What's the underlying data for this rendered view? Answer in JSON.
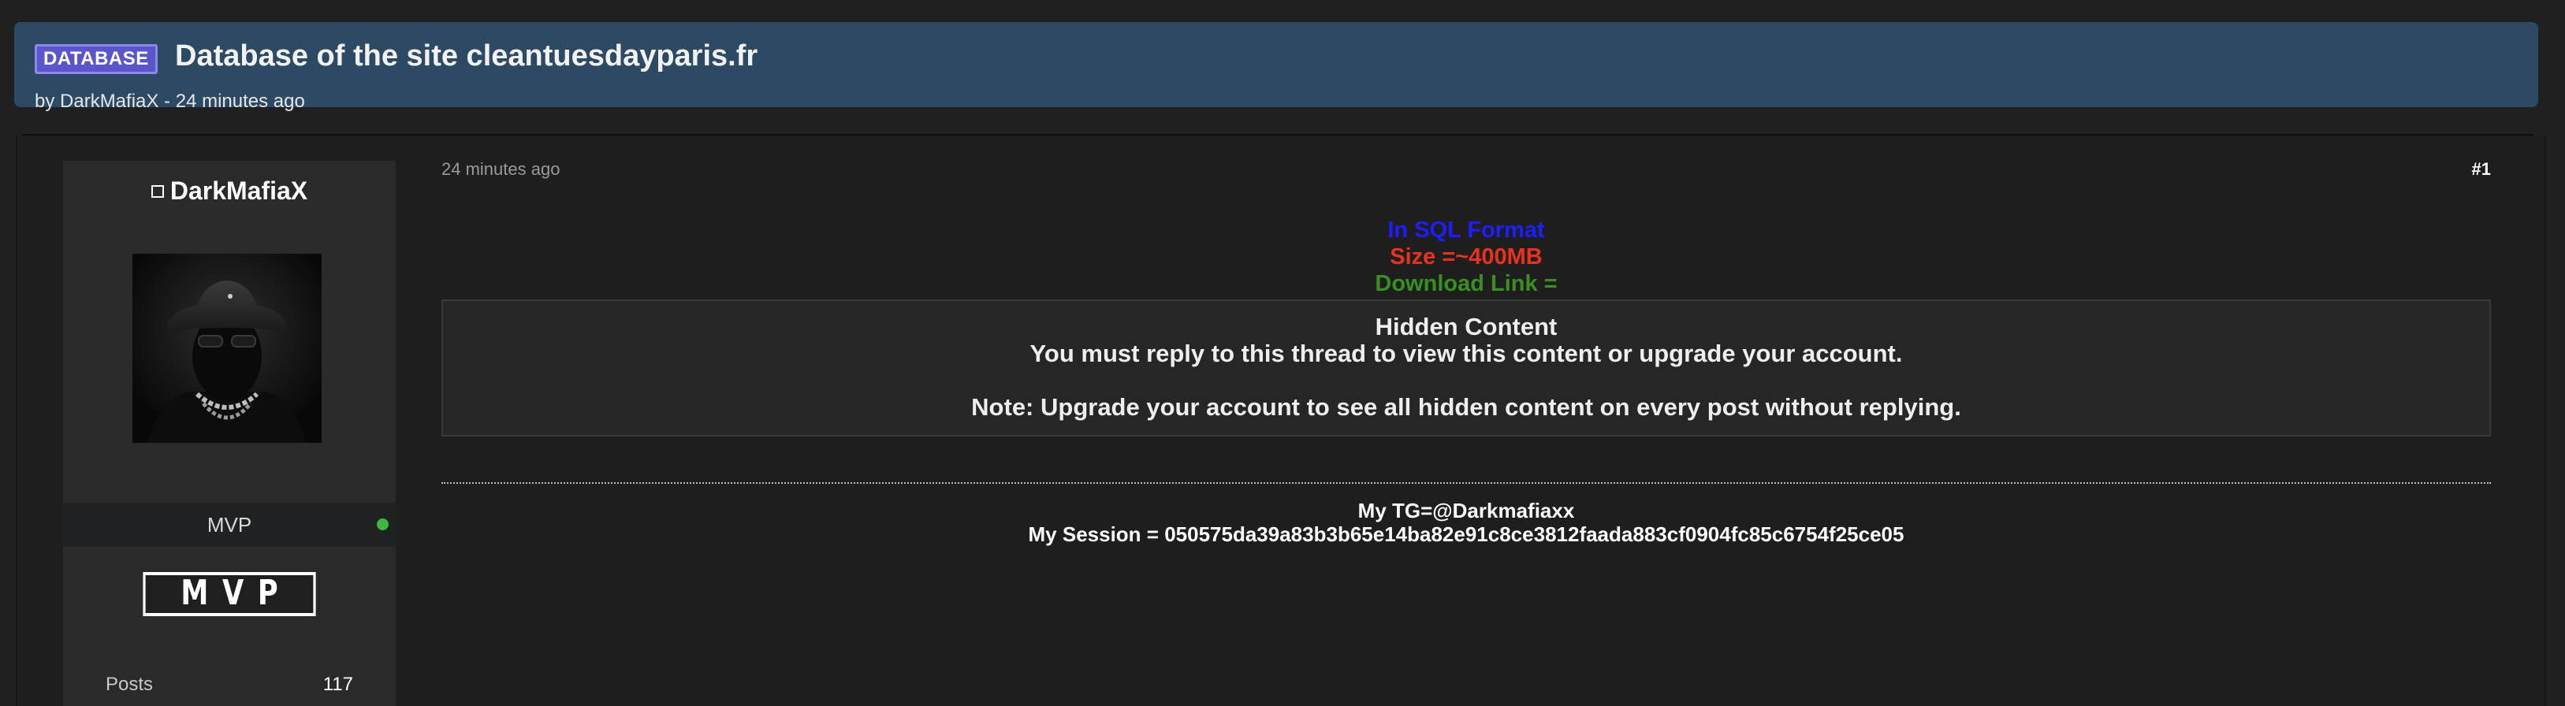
{
  "thread": {
    "prefix_badge": "DATABASE",
    "title": "Database of the site cleantuesdayparis.fr",
    "by_prefix": "by ",
    "author": "DarkMafiaX",
    "separator": " - ",
    "time": "24 minutes ago"
  },
  "user": {
    "name": "DarkMafiaX",
    "rank": "MVP",
    "rank_banner": "MVP",
    "online": true,
    "online_color": "#3db83d",
    "stats": [
      {
        "label": "Posts",
        "value": "117"
      }
    ]
  },
  "post": {
    "time": "24 minutes ago",
    "number": "#1",
    "lines": {
      "format": "In SQL Format",
      "size": "Size =~400MB",
      "download": "Download Link ="
    },
    "hidden": {
      "title": "Hidden Content",
      "message": "You must reply to this thread to view this content or upgrade your account.",
      "note": "Note: Upgrade your account to see all hidden content on every post without replying."
    }
  },
  "signature": {
    "tg": "My TG=@Darkmafiaxx",
    "session": "My Session = 050575da39a83b3b65e14ba82e91c8ce3812faada883cf0904fc85c6754f25ce05"
  },
  "colors": {
    "header_bg": "#2d4a65",
    "badge_bg": "#5a55c9",
    "format_text": "#1d1dff",
    "size_text": "#e8321d",
    "download_text": "#3a8f23"
  },
  "icons": {
    "avatar": "masked-person-bucket-hat-avatar",
    "username_prefix": "square-icon",
    "online": "online-dot-icon"
  }
}
